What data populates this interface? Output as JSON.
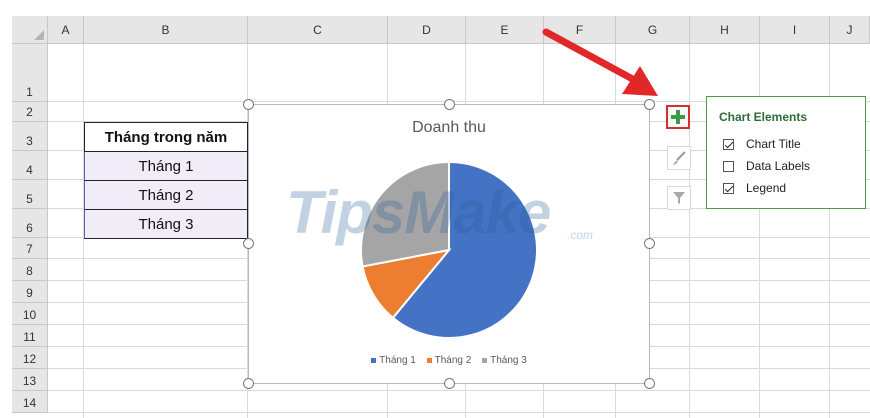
{
  "column_headers": [
    "A",
    "B",
    "C",
    "D",
    "E",
    "F",
    "G",
    "H",
    "I",
    "J"
  ],
  "row_headers": [
    "1",
    "2",
    "3",
    "4",
    "5",
    "6",
    "7",
    "8",
    "9",
    "10",
    "11",
    "12",
    "13",
    "14"
  ],
  "table": {
    "header": "Tháng trong năm",
    "rows": [
      "Tháng 1",
      "Tháng 2",
      "Tháng 3"
    ]
  },
  "watermark": {
    "main": "TipsMake",
    "suffix": ".com"
  },
  "chart": {
    "title": "Doanh thu",
    "legend": [
      "Tháng 1",
      "Tháng 2",
      "Tháng 3"
    ]
  },
  "chart_data": {
    "type": "pie",
    "title": "Doanh thu",
    "categories": [
      "Tháng 1",
      "Tháng 2",
      "Tháng 3"
    ],
    "values": [
      61,
      11,
      28
    ],
    "colors": [
      "#4472c4",
      "#ed7d31",
      "#a5a5a5"
    ],
    "legend_position": "bottom"
  },
  "side_buttons": {
    "plus_icon": "plus-icon",
    "brush_icon": "paintbrush-icon",
    "filter_icon": "funnel-icon"
  },
  "chart_elements_panel": {
    "title": "Chart Elements",
    "options": [
      {
        "label": "Chart Title",
        "checked": true
      },
      {
        "label": "Data Labels",
        "checked": false
      },
      {
        "label": "Legend",
        "checked": true
      }
    ]
  },
  "colors": {
    "accent_red": "#e02828",
    "panel_green": "#2e6b3a"
  }
}
